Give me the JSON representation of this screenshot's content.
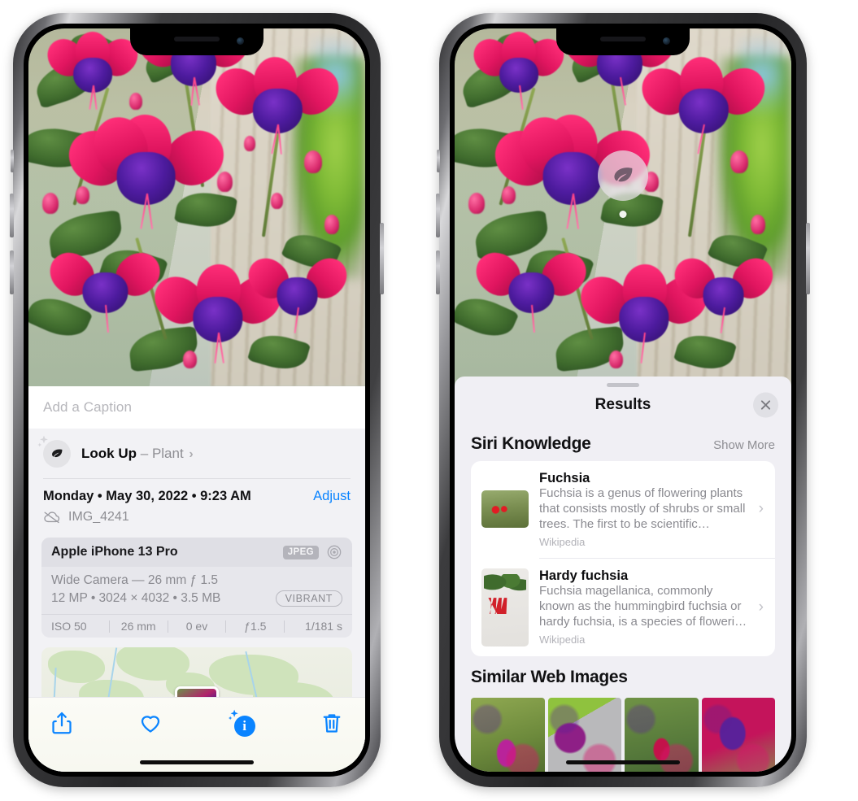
{
  "left_phone": {
    "photo": {
      "alt": "fuchsia-flowers-photo"
    },
    "caption": {
      "placeholder": "Add a Caption",
      "value": ""
    },
    "look_up": {
      "label": "Look Up",
      "separator": "–",
      "subject": "Plant",
      "chevron": "›",
      "icon": "leaf-icon",
      "sparkle_icon": "sparkles-icon"
    },
    "date_row": {
      "date": "Monday • May 30, 2022 • 9:23 AM",
      "adjust_label": "Adjust"
    },
    "file_row": {
      "icon": "cloud-slash-icon",
      "filename": "IMG_4241"
    },
    "metadata_card": {
      "device": "Apple iPhone 13 Pro",
      "format_badge": "JPEG",
      "aperture_icon": "aperture-icon",
      "lens": "Wide Camera — 26 mm ƒ 1.5",
      "resolution": "12 MP • 3024 × 4032 • 3.5 MB",
      "style_badge": "VIBRANT",
      "exif": [
        "ISO 50",
        "26 mm",
        "0 ev",
        "ƒ1.5",
        "1/181 s"
      ]
    },
    "map": {
      "label": "photo-location-map"
    },
    "toolbar": [
      {
        "name": "share-button",
        "icon": "share-icon"
      },
      {
        "name": "favorite-button",
        "icon": "heart-icon"
      },
      {
        "name": "info-button",
        "icon": "info-sparkle-icon",
        "glyph": "i"
      },
      {
        "name": "delete-button",
        "icon": "trash-icon"
      }
    ]
  },
  "right_phone": {
    "photo": {
      "alt": "fuchsia-flowers-photo"
    },
    "visual_lookup_badge": {
      "icon": "leaf-icon"
    },
    "results_sheet": {
      "title": "Results",
      "close_label": "✕",
      "siri_knowledge": {
        "heading": "Siri Knowledge",
        "show_more": "Show More",
        "items": [
          {
            "title": "Fuchsia",
            "description": "Fuchsia is a genus of flowering plants that consists mostly of shrubs or small trees. The first to be scientific…",
            "source": "Wikipedia",
            "chevron": "›",
            "thumb": "fuchsia-thumbnail"
          },
          {
            "title": "Hardy fuchsia",
            "description": "Fuchsia magellanica, commonly known as the hummingbird fuchsia or hardy fuchsia, is a species of floweri…",
            "source": "Wikipedia",
            "chevron": "›",
            "thumb": "hardy-fuchsia-thumbnail"
          }
        ]
      },
      "similar_web_images": {
        "heading": "Similar Web Images",
        "items": [
          {
            "name": "web-image-1"
          },
          {
            "name": "web-image-2"
          },
          {
            "name": "web-image-3"
          },
          {
            "name": "web-image-4"
          }
        ]
      }
    }
  },
  "colors": {
    "accent_blue": "#0a84ff",
    "sheet_bg": "#f0eff4",
    "info_bg": "#f2f2f5",
    "secondary_text": "#8e8e93"
  }
}
